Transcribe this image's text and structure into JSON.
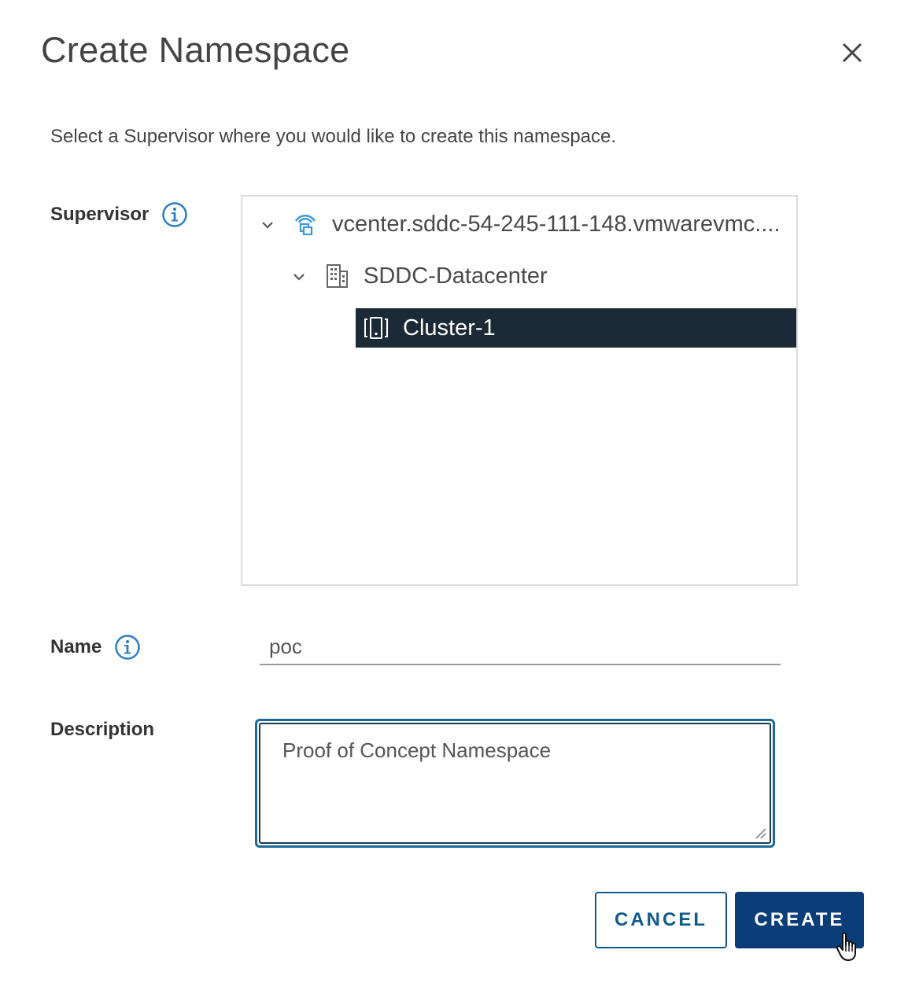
{
  "dialog": {
    "title": "Create Namespace",
    "subtitle": "Select a Supervisor where you would like to create this namespace."
  },
  "form": {
    "supervisor_label": "Supervisor",
    "name_label": "Name",
    "name_value": "poc",
    "description_label": "Description",
    "description_value": "Proof of Concept Namespace"
  },
  "tree": {
    "items": [
      {
        "label": "vcenter.sddc-54-245-111-148.vmwarevmc....",
        "icon": "vcenter-icon",
        "expanded": true,
        "selected": false
      },
      {
        "label": "SDDC-Datacenter",
        "icon": "datacenter-icon",
        "expanded": true,
        "selected": false
      },
      {
        "label": "Cluster-1",
        "icon": "cluster-icon",
        "expanded": false,
        "selected": true
      }
    ]
  },
  "buttons": {
    "cancel": "CANCEL",
    "create": "CREATE"
  },
  "colors": {
    "selected_row_bg": "#1b2a36",
    "primary_button": "#0b3d78",
    "focus_border": "#1b6b94",
    "info_icon": "#2e7fbf"
  }
}
